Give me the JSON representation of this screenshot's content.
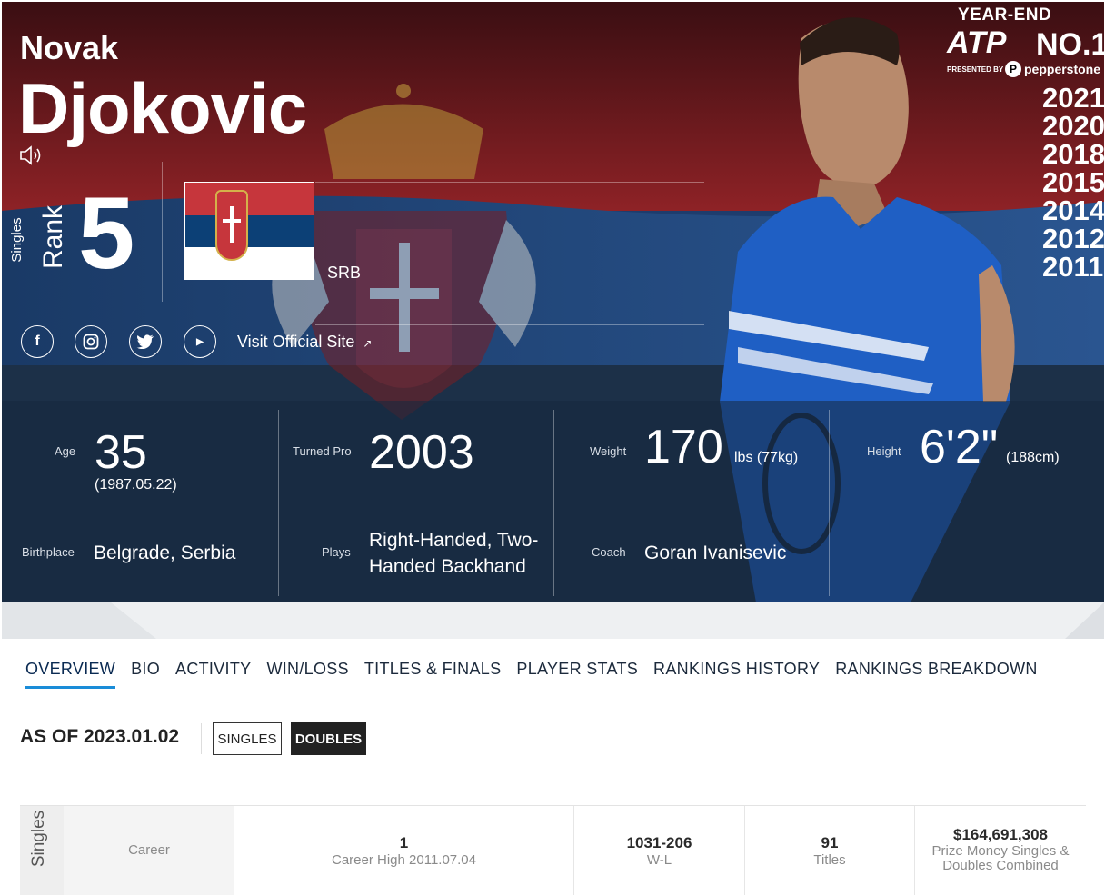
{
  "player": {
    "first_name": "Novak",
    "last_name": "Djokovic",
    "rank_type": "Singles",
    "rank_label": "Rank",
    "rank": "5",
    "country_code": "SRB",
    "official_site": "Visit Official Site"
  },
  "year_end": {
    "title": "YEAR-END",
    "brand": "ATP",
    "no1": "NO.1",
    "presented_by": "PRESENTED BY",
    "sponsor": "pepperstone",
    "years": [
      "2021",
      "2020",
      "2018",
      "2015",
      "2014",
      "2012",
      "2011"
    ]
  },
  "stats": {
    "age_label": "Age",
    "age": "35",
    "birth_date": "(1987.05.22)",
    "turned_pro_label": "Turned Pro",
    "turned_pro": "2003",
    "weight_label": "Weight",
    "weight": "170",
    "weight_unit": "lbs (77kg)",
    "height_label": "Height",
    "height": "6'2\"",
    "height_unit": "(188cm)",
    "birthplace_label": "Birthplace",
    "birthplace": "Belgrade, Serbia",
    "plays_label": "Plays",
    "plays_line1": "Right-Handed, Two-",
    "plays_line2": "Handed Backhand",
    "coach_label": "Coach",
    "coach": "Goran Ivanisevic"
  },
  "tabs": [
    "OVERVIEW",
    "BIO",
    "ACTIVITY",
    "WIN/LOSS",
    "TITLES & FINALS",
    "PLAYER STATS",
    "RANKINGS HISTORY",
    "RANKINGS BREAKDOWN"
  ],
  "as_of": "AS OF 2023.01.02",
  "toggle": {
    "singles": "SINGLES",
    "doubles": "DOUBLES"
  },
  "career": {
    "side_label": "Singles",
    "row_label": "Career",
    "high_value": "1",
    "high_label": "Career High 2011.07.04",
    "wl_value": "1031-206",
    "wl_label": "W-L",
    "titles_value": "91",
    "titles_label": "Titles",
    "prize_value": "$164,691,308",
    "prize_label_1": "Prize Money Singles &",
    "prize_label_2": "Doubles Combined"
  },
  "colors": {
    "flag_red": "#c6363c",
    "flag_blue": "#0c4076",
    "tab_underline": "#1a8cd8",
    "shirt_blue": "#1f5fc4"
  }
}
